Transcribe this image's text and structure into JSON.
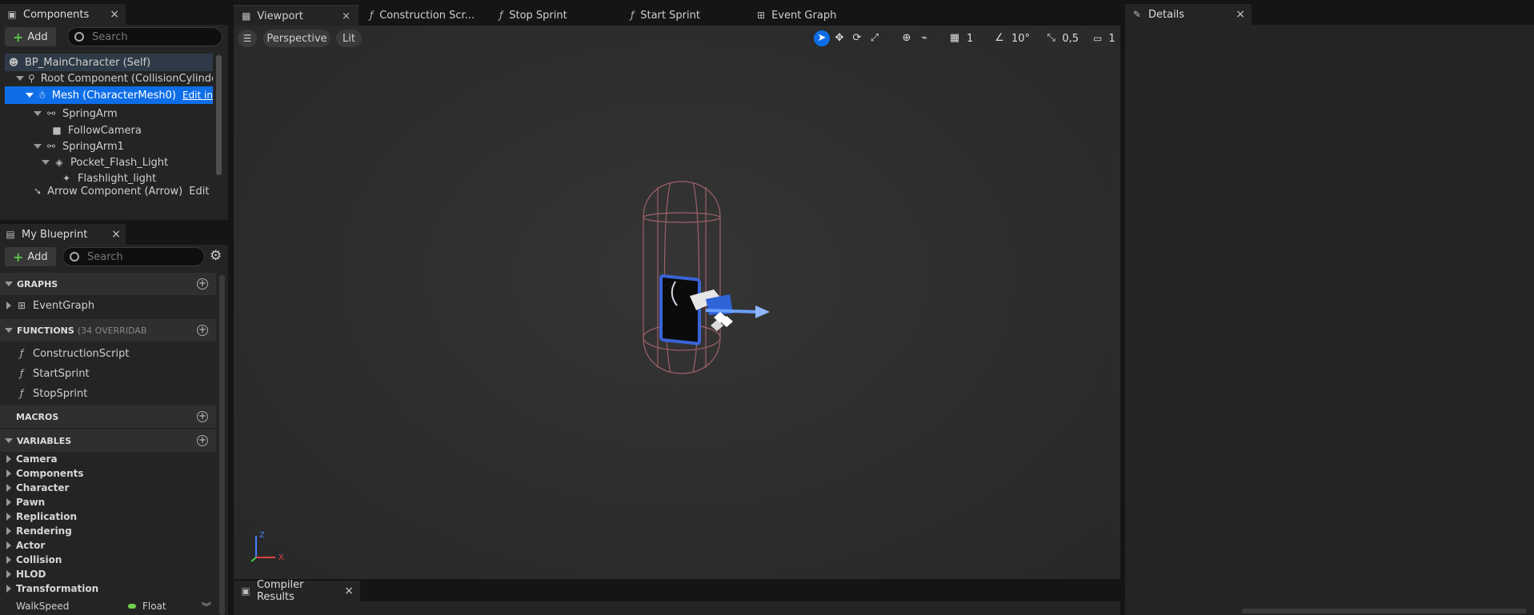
{
  "tabs": {
    "components": "Components",
    "viewport": "Viewport",
    "construction": "Construction Scr...",
    "stop_sprint": "Stop Sprint",
    "start_sprint": "Start Sprint",
    "event_graph": "Event Graph",
    "details": "Details",
    "my_blueprint": "My Blueprint",
    "compiler_results": "Compiler Results",
    "close": "×"
  },
  "components": {
    "add_label": "Add",
    "search_placeholder": "Search",
    "tree": [
      {
        "label": "BP_MainCharacter (Self)"
      },
      {
        "label": "Root Component (CollisionCylinder)"
      },
      {
        "label": "Mesh (CharacterMesh0)",
        "link": "Edit in C++"
      },
      {
        "label": "SpringArm"
      },
      {
        "label": "FollowCamera"
      },
      {
        "label": "SpringArm1"
      },
      {
        "label": "Pocket_Flash_Light"
      },
      {
        "label": "Flashlight_light"
      },
      {
        "label": "Arrow Component (Arrow)",
        "link": "Edit in C++"
      }
    ]
  },
  "blueprint": {
    "add_label": "Add",
    "search_placeholder": "Search",
    "graphs": "GRAPHS",
    "event_graph": "EventGraph",
    "functions": "FUNCTIONS",
    "functions_count": "(34 OVERRIDAB",
    "function_items": [
      "ConstructionScript",
      "StartSprint",
      "StopSprint"
    ],
    "macros": "MACROS",
    "variables": "VARIABLES",
    "categories": [
      "Camera",
      "Components",
      "Character",
      "Pawn",
      "Replication",
      "Rendering",
      "Actor",
      "Collision",
      "HLOD",
      "Transformation"
    ],
    "walkspeed": {
      "name": "WalkSpeed",
      "type": "Float"
    }
  },
  "viewport": {
    "perspective": "Perspective",
    "lit": "Lit",
    "grid_value": "1",
    "angle_value": "10°",
    "scale_value": "0,5",
    "camera_value": "1",
    "axis_x": "X",
    "axis_z": "Z"
  },
  "colors": {
    "accent": "#0e6ee8",
    "panel": "#242424",
    "viewport_bg": "#2d2d2d",
    "capsule": "#b06a72"
  }
}
